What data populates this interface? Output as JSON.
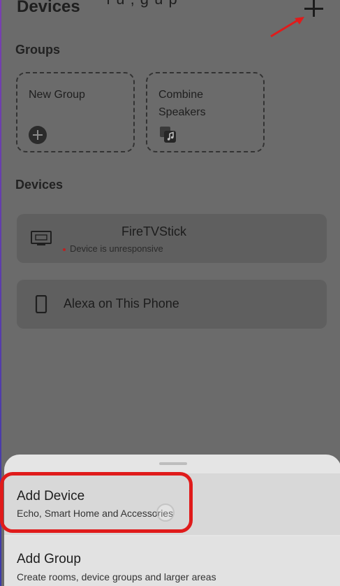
{
  "header": {
    "title": "Devices",
    "title_fragment": "ı    u  , g  u p"
  },
  "groups_section": {
    "label": "Groups",
    "cards": [
      {
        "label": "New Group",
        "icon": "plus-circle-icon"
      },
      {
        "label": "Combine\nSpeakers",
        "icon": "speakers-icon"
      }
    ]
  },
  "devices_section": {
    "label": "Devices",
    "items": [
      {
        "name": "FireTVStick",
        "status": "Device is unresponsive",
        "icon": "tv-icon"
      },
      {
        "name": "Alexa on This Phone",
        "icon": "phone-icon"
      }
    ]
  },
  "bottom_sheet": {
    "items": [
      {
        "title": "Add Device",
        "subtitle": "Echo, Smart Home and Accessories"
      },
      {
        "title": "Add Group",
        "subtitle": "Create rooms, device groups and larger areas"
      }
    ]
  },
  "colors": {
    "annotation_red": "#e01b1b",
    "overlay_gray": "#6b6b6b",
    "sheet_bg": "#e5e5e5"
  }
}
